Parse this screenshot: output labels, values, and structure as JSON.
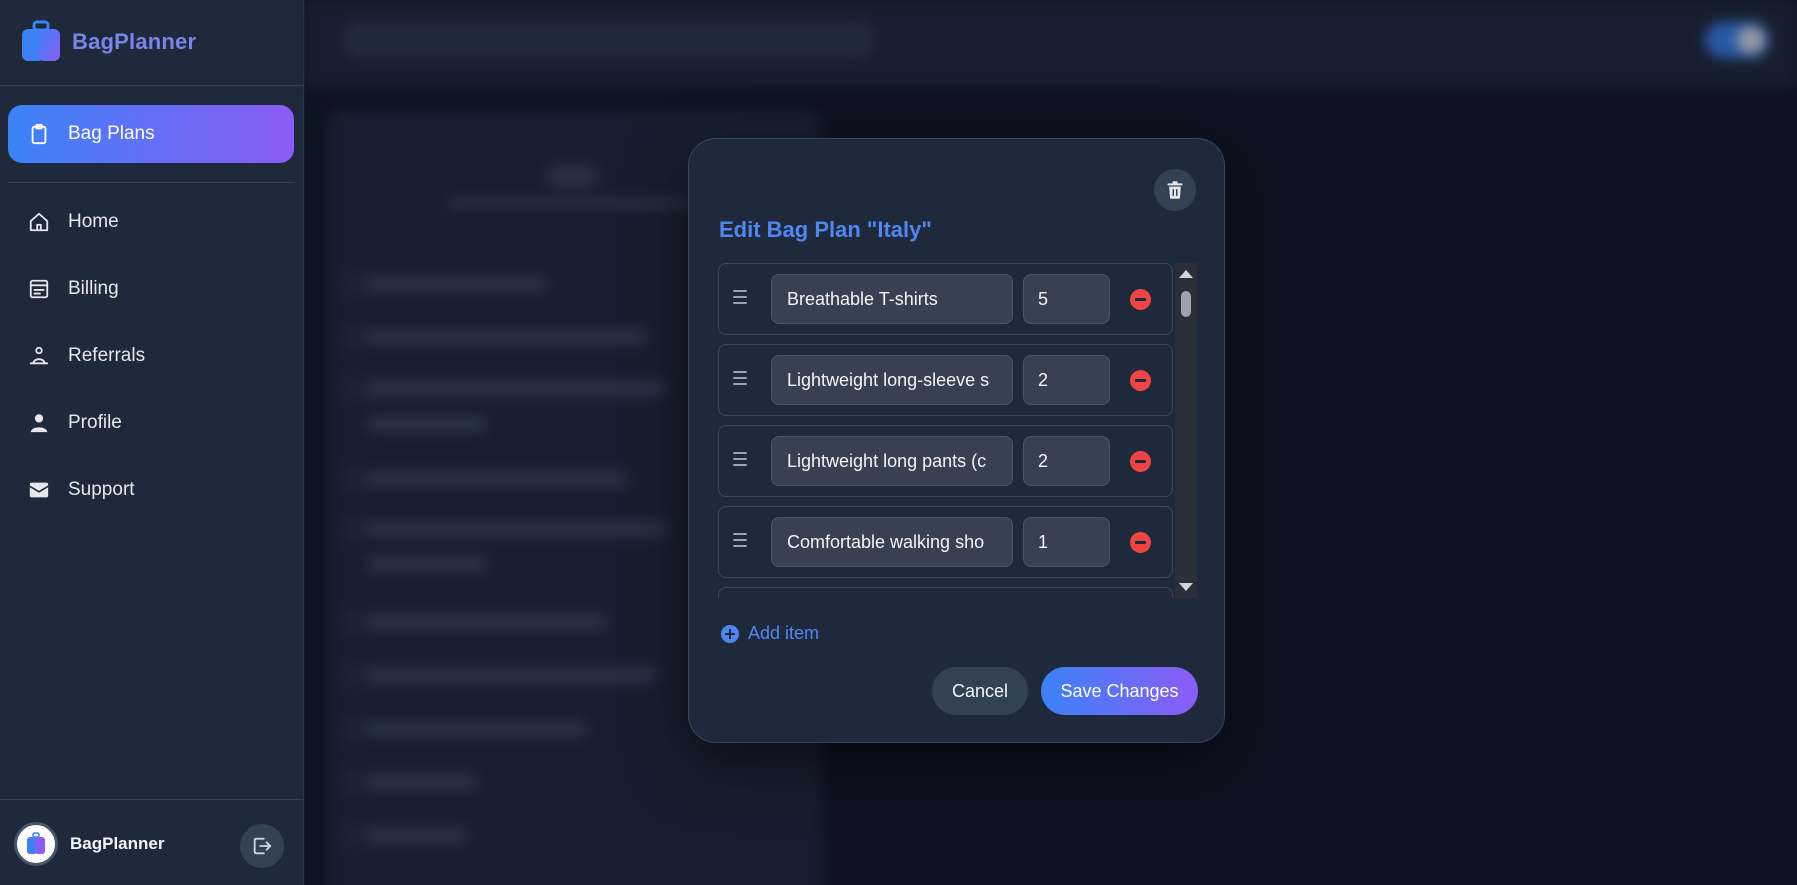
{
  "brand": {
    "name": "BagPlanner",
    "icon": "luggage-icon"
  },
  "sidebar": {
    "items": [
      {
        "label": "Bag Plans",
        "icon": "clipboard-icon",
        "active": true
      },
      {
        "label": "Home",
        "icon": "home-icon",
        "active": false
      },
      {
        "label": "Billing",
        "icon": "billing-icon",
        "active": false
      },
      {
        "label": "Referrals",
        "icon": "referrals-icon",
        "active": false
      },
      {
        "label": "Profile",
        "icon": "user-icon",
        "active": false
      },
      {
        "label": "Support",
        "icon": "envelope-icon",
        "active": false
      }
    ]
  },
  "footer": {
    "name": "BagPlanner",
    "logout_icon": "logout-icon"
  },
  "modal": {
    "title": "Edit Bag Plan \"Italy\"",
    "delete_icon": "trash-icon",
    "items": [
      {
        "name": "Breathable T-shirts",
        "qty": "5"
      },
      {
        "name": "Lightweight long-sleeve s",
        "qty": "2"
      },
      {
        "name": "Lightweight long pants (c",
        "qty": "2"
      },
      {
        "name": "Comfortable walking sho",
        "qty": "1"
      },
      {
        "name": "",
        "qty": ""
      }
    ],
    "add_item_label": "Add item",
    "cancel_label": "Cancel",
    "save_label": "Save Changes"
  },
  "colors": {
    "accent_start": "#3b82f6",
    "accent_end": "#8b5cf6",
    "title": "#4f86f0",
    "danger": "#ef4444"
  }
}
